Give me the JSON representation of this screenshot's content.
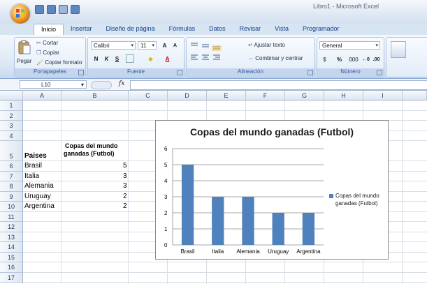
{
  "window": {
    "title": "Libro1 - Microsoft Excel"
  },
  "tabs": [
    "Inicio",
    "Insertar",
    "Diseño de página",
    "Fórmulas",
    "Datos",
    "Revisar",
    "Vista",
    "Programador"
  ],
  "ribbon": {
    "portapapeles": {
      "label": "Portapapeles",
      "pegar": "Pegar",
      "cortar": "Cortar",
      "copiar": "Copiar",
      "copiar_formato": "Copiar formato"
    },
    "fuente": {
      "label": "Fuente",
      "font_name": "Calibri",
      "font_size": "11",
      "bold": "N",
      "italic": "K",
      "underline": "S"
    },
    "alineacion": {
      "label": "Alineación",
      "ajustar": "Ajustar texto",
      "combinar": "Combinar y centrar"
    },
    "numero": {
      "label": "Número",
      "format": "General",
      "percent": "%",
      "thousands": "000"
    }
  },
  "formula_bar": {
    "name_box": "L10",
    "fx": "fx",
    "value": ""
  },
  "columns": [
    "A",
    "B",
    "C",
    "D",
    "E",
    "F",
    "G",
    "H",
    "I"
  ],
  "rows": [
    "1",
    "2",
    "3",
    "4",
    "5",
    "6",
    "7",
    "8",
    "9",
    "10",
    "11",
    "12",
    "13",
    "14",
    "15",
    "16",
    "17"
  ],
  "cells": {
    "a5": "Paises",
    "b5_line1": "Copas del mundo",
    "b5_line2": "ganadas (Futbol)",
    "data": [
      {
        "pais": "Brasil",
        "copas": "5"
      },
      {
        "pais": "Italia",
        "copas": "3"
      },
      {
        "pais": "Alemania",
        "copas": "3"
      },
      {
        "pais": "Uruguay",
        "copas": "2"
      },
      {
        "pais": "Argentina",
        "copas": "2"
      }
    ]
  },
  "chart_data": {
    "type": "bar",
    "title": "Copas del mundo ganadas (Futbol)",
    "categories": [
      "Brasil",
      "Italia",
      "Alemania",
      "Uruguay",
      "Argentina"
    ],
    "series": [
      {
        "name": "Copas del mundo ganadas (Futbol)",
        "values": [
          5,
          3,
          3,
          2,
          2
        ]
      }
    ],
    "ylim": [
      0,
      6
    ],
    "yticks": [
      "0",
      "1",
      "2",
      "3",
      "4",
      "5",
      "6"
    ],
    "grid": true,
    "legend": "right",
    "color": "#4f81bd",
    "legend_line1": "Copas del mundo",
    "legend_line2": "ganadas (Futbol)"
  }
}
